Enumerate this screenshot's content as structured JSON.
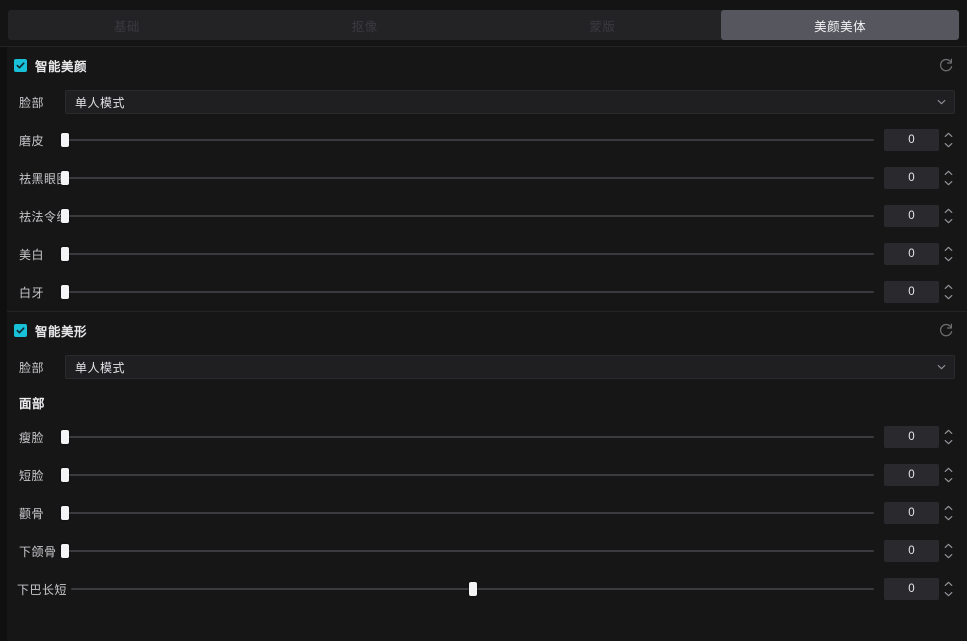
{
  "tabs": [
    {
      "label": "基础",
      "active": false
    },
    {
      "label": "抠像",
      "active": false
    },
    {
      "label": "蒙版",
      "active": false
    },
    {
      "label": "美颜美体",
      "active": true
    }
  ],
  "icons": {
    "check": "check-icon",
    "reset": "reset-icon",
    "caret_down": "chevron-down-icon",
    "spin_up": "chevron-up-icon",
    "spin_down": "chevron-down-icon"
  },
  "colors": {
    "accent": "#18c0d8",
    "panel_bg": "#161617",
    "tabbar_bg": "#232326",
    "tab_active_bg": "#56565e",
    "track": "#3b3b3f",
    "thumb": "#f4f4f6",
    "spin_bg": "#2a2a2e"
  },
  "sections": [
    {
      "id": "smart-beauty",
      "title": "智能美颜",
      "enabled": true,
      "face_label": "脸部",
      "face_mode": "单人模式",
      "sliders": [
        {
          "label": "磨皮",
          "value": "0",
          "percent": 0
        },
        {
          "label": "祛黑眼圈",
          "value": "0",
          "percent": 0
        },
        {
          "label": "祛法令纹",
          "value": "0",
          "percent": 0
        },
        {
          "label": "美白",
          "value": "0",
          "percent": 0
        },
        {
          "label": "白牙",
          "value": "0",
          "percent": 0
        }
      ]
    },
    {
      "id": "smart-reshape",
      "title": "智能美形",
      "enabled": true,
      "face_label": "脸部",
      "face_mode": "单人模式",
      "group_label": "面部",
      "sliders": [
        {
          "label": "瘦脸",
          "value": "0",
          "percent": 0
        },
        {
          "label": "短脸",
          "value": "0",
          "percent": 0
        },
        {
          "label": "颧骨",
          "value": "0",
          "percent": 0
        },
        {
          "label": "下颌骨",
          "value": "0",
          "percent": 0
        },
        {
          "label": "下巴长短",
          "value": "0",
          "percent": 50
        }
      ]
    }
  ]
}
